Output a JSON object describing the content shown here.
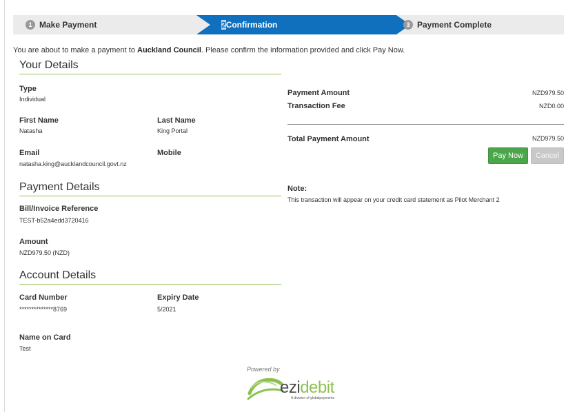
{
  "stepper": {
    "steps": [
      {
        "num": "1",
        "label": "Make Payment"
      },
      {
        "num": "2",
        "label": "Confirmation"
      },
      {
        "num": "3",
        "label": "Payment Complete"
      }
    ],
    "active_index": 1
  },
  "intro": {
    "prefix": "You are about to make a payment to ",
    "merchant": "Auckland Council",
    "suffix": ". Please confirm the information provided and click Pay Now."
  },
  "your_details": {
    "title": "Your Details",
    "type_label": "Type",
    "type_value": "Individual",
    "first_name_label": "First Name",
    "first_name_value": "Natasha",
    "last_name_label": "Last Name",
    "last_name_value": "King Portal",
    "email_label": "Email",
    "email_value": "natasha.king@aucklandcouncil.govt.nz",
    "mobile_label": "Mobile",
    "mobile_value": ""
  },
  "payment_details": {
    "title": "Payment Details",
    "reference_label": "Bill/Invoice Reference",
    "reference_value": "TEST-b52a4edd3720416",
    "amount_label": "Amount",
    "amount_value": "NZD979.50 (NZD)"
  },
  "account_details": {
    "title": "Account Details",
    "card_number_label": "Card Number",
    "card_number_value": "**************8769",
    "expiry_label": "Expiry Date",
    "expiry_value": "5/2021",
    "name_label": "Name on Card",
    "name_value": "Test"
  },
  "summary": {
    "payment_amount_label": "Payment Amount",
    "payment_amount_value": "NZD979.50",
    "fee_label": "Transaction Fee",
    "fee_value": "NZD0.00",
    "total_label": "Total Payment Amount",
    "total_value": "NZD979.50",
    "pay_label": "Pay Now",
    "cancel_label": "Cancel",
    "note_label": "Note:",
    "note_text": "This transaction will appear on your credit card statement as Pilot Merchant 2"
  },
  "footer": {
    "powered_by": "Powered by",
    "logo_prefix": "ezi",
    "logo_suffix": "debit",
    "logo_tagline": "A division of globalpayments"
  },
  "colors": {
    "active_step": "#1070bd",
    "accent_green": "#8cc152",
    "pay_button": "#4ba64b",
    "cancel_button": "#c8c8c8"
  }
}
